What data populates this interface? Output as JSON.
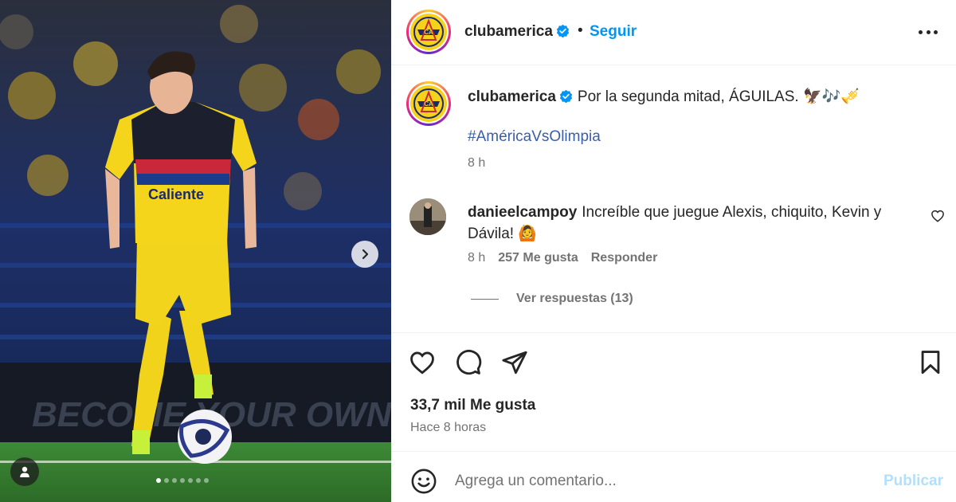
{
  "post": {
    "username": "clubamerica",
    "follow_label": "Seguir",
    "separator": "•",
    "more_icon": "more-options-icon",
    "caption_text": "Por la segunda mitad, ÁGUILAS. 🦅🎶🎺",
    "hashtag": "#AméricaVsOlimpia",
    "caption_time": "8 h",
    "likes": "33,7 mil Me gusta",
    "posted": "Hace 8 horas"
  },
  "comment": {
    "username": "danieelcampoy",
    "text": "Increíble que juegue Alexis, chiquito, Kevin y Dávila! 🙆",
    "time": "8 h",
    "likes": "257 Me gusta",
    "reply_label": "Responder",
    "view_replies": "Ver respuestas (13)"
  },
  "composer": {
    "placeholder": "Agrega un comentario...",
    "publish_label": "Publicar"
  },
  "carousel": {
    "total_slides": 7,
    "current_slide": 1
  },
  "colors": {
    "link": "#0095f6",
    "hashtag": "#3b5ea8",
    "publish_disabled": "#b2dffc",
    "club_yellow": "#f6d21b",
    "club_navy": "#1b2a6b"
  }
}
